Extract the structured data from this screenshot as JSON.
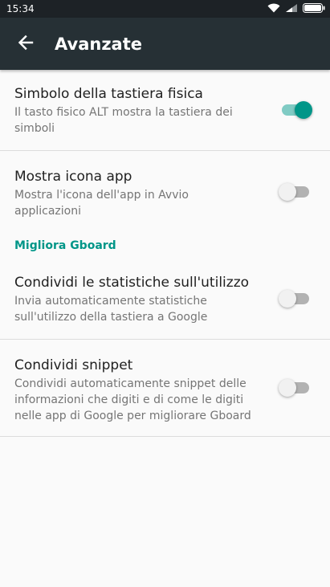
{
  "status_bar": {
    "time": "15:34",
    "icons": [
      "wifi-icon",
      "signal-icon",
      "battery-icon"
    ]
  },
  "app_bar": {
    "back_icon": "arrow-back-icon",
    "title": "Avanzate"
  },
  "settings": [
    {
      "title": "Simbolo della tastiera fisica",
      "summary": "Il tasto fisico ALT mostra la tastiera dei simboli",
      "enabled": true
    },
    {
      "title": "Mostra icona app",
      "summary": "Mostra l'icona dell'app in Avvio applicazioni",
      "enabled": false
    }
  ],
  "section": {
    "header": "Migliora Gboard",
    "items": [
      {
        "title": "Condividi le statistiche sull'utilizzo",
        "summary": "Invia automaticamente statistiche sull'utilizzo della tastiera a Google",
        "enabled": false
      },
      {
        "title": "Condividi snippet",
        "summary": "Condividi automaticamente snippet delle informazioni che digiti e di come le digiti nelle app di Google per migliorare Gboard",
        "enabled": false
      }
    ]
  },
  "colors": {
    "accent": "#009688",
    "accent_light": "#80cbc4",
    "app_bar": "#263035",
    "status_bar": "#1d2226",
    "background": "#fafafa"
  }
}
